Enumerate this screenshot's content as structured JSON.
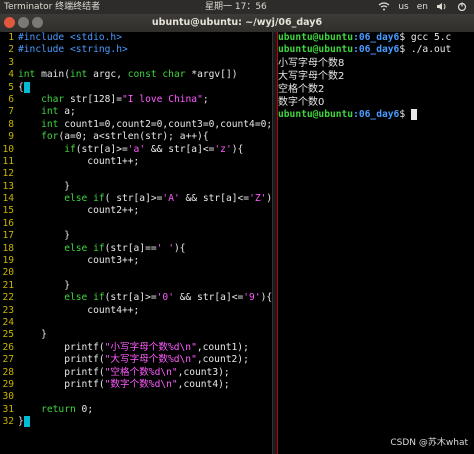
{
  "topbar": {
    "app_name": "Terminator 终端终结者",
    "clock": "星期一 17：56",
    "keyboard_indicator": "us",
    "language": "en"
  },
  "window": {
    "title": "ubuntu@ubuntu: ~/wyj/06_day6"
  },
  "editor_lines": [
    {
      "n": "1",
      "segs": [
        {
          "t": "#include <stdio.h>",
          "c": "pre"
        }
      ]
    },
    {
      "n": "2",
      "segs": [
        {
          "t": "#include <string.h>",
          "c": "pre"
        }
      ]
    },
    {
      "n": "3",
      "segs": []
    },
    {
      "n": "4",
      "segs": [
        {
          "t": "int",
          "c": "kw"
        },
        {
          "t": " main(",
          "c": "plain"
        },
        {
          "t": "int",
          "c": "kw"
        },
        {
          "t": " argc, ",
          "c": "plain"
        },
        {
          "t": "const char",
          "c": "kw"
        },
        {
          "t": " *argv[])",
          "c": "plain"
        }
      ]
    },
    {
      "n": "5",
      "segs": [
        {
          "t": "{",
          "c": "plain"
        }
      ],
      "cursor": true
    },
    {
      "n": "6",
      "segs": [
        {
          "t": "    ",
          "c": "plain"
        },
        {
          "t": "char",
          "c": "kw"
        },
        {
          "t": " str[128]=",
          "c": "plain"
        },
        {
          "t": "\"I love China\"",
          "c": "str"
        },
        {
          "t": ";",
          "c": "plain"
        }
      ]
    },
    {
      "n": "7",
      "segs": [
        {
          "t": "    ",
          "c": "plain"
        },
        {
          "t": "int",
          "c": "kw"
        },
        {
          "t": " a;",
          "c": "plain"
        }
      ]
    },
    {
      "n": "8",
      "segs": [
        {
          "t": "    ",
          "c": "plain"
        },
        {
          "t": "int",
          "c": "kw"
        },
        {
          "t": " count1=0,count2=0,count3=0,count4=0;",
          "c": "plain"
        }
      ]
    },
    {
      "n": "9",
      "segs": [
        {
          "t": "    ",
          "c": "plain"
        },
        {
          "t": "for",
          "c": "kw"
        },
        {
          "t": "(a=0; a<strlen(str); a++){",
          "c": "plain"
        }
      ]
    },
    {
      "n": "10",
      "segs": [
        {
          "t": "        ",
          "c": "plain"
        },
        {
          "t": "if",
          "c": "kw"
        },
        {
          "t": "(str[a]>=",
          "c": "plain"
        },
        {
          "t": "'a'",
          "c": "str"
        },
        {
          "t": " && str[a]<=",
          "c": "plain"
        },
        {
          "t": "'z'",
          "c": "str"
        },
        {
          "t": "){",
          "c": "plain"
        }
      ]
    },
    {
      "n": "11",
      "segs": [
        {
          "t": "            count1++;",
          "c": "plain"
        }
      ]
    },
    {
      "n": "12",
      "segs": []
    },
    {
      "n": "13",
      "segs": [
        {
          "t": "        }",
          "c": "plain"
        }
      ]
    },
    {
      "n": "14",
      "segs": [
        {
          "t": "        ",
          "c": "plain"
        },
        {
          "t": "else if",
          "c": "kw"
        },
        {
          "t": "( str[a]>=",
          "c": "plain"
        },
        {
          "t": "'A'",
          "c": "str"
        },
        {
          "t": " && str[a]<=",
          "c": "plain"
        },
        {
          "t": "'Z'",
          "c": "str"
        },
        {
          "t": "){",
          "c": "plain"
        }
      ]
    },
    {
      "n": "15",
      "segs": [
        {
          "t": "            count2++;",
          "c": "plain"
        }
      ]
    },
    {
      "n": "16",
      "segs": []
    },
    {
      "n": "17",
      "segs": [
        {
          "t": "        }",
          "c": "plain"
        }
      ]
    },
    {
      "n": "18",
      "segs": [
        {
          "t": "        ",
          "c": "plain"
        },
        {
          "t": "else if",
          "c": "kw"
        },
        {
          "t": "(str[a]==",
          "c": "plain"
        },
        {
          "t": "' '",
          "c": "str"
        },
        {
          "t": "){",
          "c": "plain"
        }
      ]
    },
    {
      "n": "19",
      "segs": [
        {
          "t": "            count3++;",
          "c": "plain"
        }
      ]
    },
    {
      "n": "20",
      "segs": []
    },
    {
      "n": "21",
      "segs": [
        {
          "t": "        }",
          "c": "plain"
        }
      ]
    },
    {
      "n": "22",
      "segs": [
        {
          "t": "        ",
          "c": "plain"
        },
        {
          "t": "else if",
          "c": "kw"
        },
        {
          "t": "(str[a]>=",
          "c": "plain"
        },
        {
          "t": "'0'",
          "c": "str"
        },
        {
          "t": " && str[a]<=",
          "c": "plain"
        },
        {
          "t": "'9'",
          "c": "str"
        },
        {
          "t": "){",
          "c": "plain"
        }
      ]
    },
    {
      "n": "23",
      "segs": [
        {
          "t": "            count4++;",
          "c": "plain"
        }
      ]
    },
    {
      "n": "24",
      "segs": []
    },
    {
      "n": "25",
      "segs": [
        {
          "t": "    }",
          "c": "plain"
        }
      ]
    },
    {
      "n": "26",
      "segs": [
        {
          "t": "        printf(",
          "c": "plain"
        },
        {
          "t": "\"小写字母个数%d\\n\"",
          "c": "str"
        },
        {
          "t": ",count1);",
          "c": "plain"
        }
      ]
    },
    {
      "n": "27",
      "segs": [
        {
          "t": "        printf(",
          "c": "plain"
        },
        {
          "t": "\"大写字母个数%d\\n\"",
          "c": "str"
        },
        {
          "t": ",count2);",
          "c": "plain"
        }
      ]
    },
    {
      "n": "28",
      "segs": [
        {
          "t": "        printf(",
          "c": "plain"
        },
        {
          "t": "\"空格个数%d\\n\"",
          "c": "str"
        },
        {
          "t": ",count3);",
          "c": "plain"
        }
      ]
    },
    {
      "n": "29",
      "segs": [
        {
          "t": "        printf(",
          "c": "plain"
        },
        {
          "t": "\"数字个数%d\\n\"",
          "c": "str"
        },
        {
          "t": ",count4);",
          "c": "plain"
        }
      ]
    },
    {
      "n": "30",
      "segs": []
    },
    {
      "n": "31",
      "segs": [
        {
          "t": "    ",
          "c": "plain"
        },
        {
          "t": "return",
          "c": "kw"
        },
        {
          "t": " 0;",
          "c": "plain"
        }
      ]
    },
    {
      "n": "32",
      "segs": [
        {
          "t": "}",
          "c": "plain"
        }
      ],
      "cursor": true
    }
  ],
  "terminal": {
    "prompt_user": "ubuntu@ubuntu",
    "prompt_path": ":06_day6",
    "prompt_symbol": "$",
    "command1": " gcc 5.c",
    "command2": " ./a.out",
    "output": [
      "小写字母个数8",
      "大写字母个数2",
      "空格个数2",
      "数字个数0"
    ]
  },
  "watermark": "CSDN @苏木what",
  "colors": {
    "line_number": "#c6b400",
    "preprocessor": "#4a9bff",
    "keyword": "#3fd43f",
    "string": "#ff5cff",
    "cursor": "#00bcd4"
  }
}
